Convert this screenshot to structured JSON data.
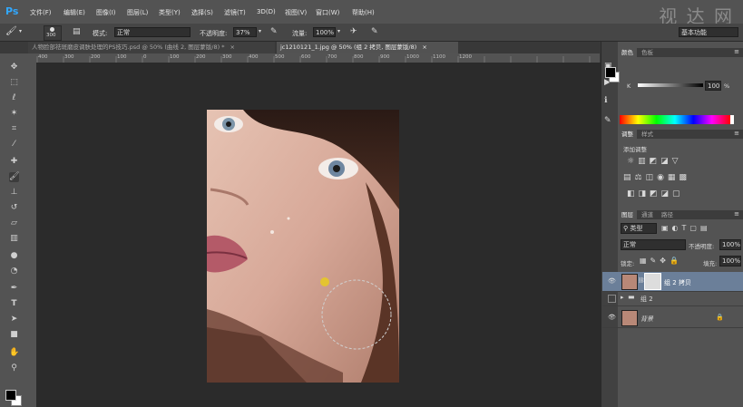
{
  "app": {
    "logo": "Ps",
    "watermark": "视 达 网"
  },
  "menu": [
    "文件(F)",
    "编辑(E)",
    "图像(I)",
    "图层(L)",
    "类型(Y)",
    "选择(S)",
    "滤镜(T)",
    "3D(D)",
    "视图(V)",
    "窗口(W)",
    "帮助(H)"
  ],
  "options": {
    "brush_size": "300",
    "mode_label": "模式:",
    "mode_value": "正常",
    "opacity_label": "不透明度:",
    "opacity_value": "37%",
    "flow_label": "流量:",
    "flow_value": "100%",
    "workspace": "基本功能"
  },
  "tabs": [
    {
      "label": "人物脸部祛斑磨皮调肤处理的PS技巧.psd @ 50% (曲线 2, 图层蒙版/8) *"
    },
    {
      "label": "jc1210121_1.jpg @ 50% (组 2 拷贝, 图层蒙版/8)"
    }
  ],
  "ruler_ticks": [
    "400",
    "350",
    "300",
    "250",
    "200",
    "150",
    "100",
    "50",
    "0",
    "50",
    "100",
    "150",
    "200",
    "250",
    "300",
    "350",
    "400",
    "450",
    "500",
    "550",
    "600",
    "650",
    "700",
    "750",
    "800",
    "850",
    "900",
    "950",
    "1000",
    "1050",
    "1100",
    "1150",
    "1200"
  ],
  "color_panel": {
    "tab_color": "颜色",
    "tab_swatches": "色板",
    "channel": "K",
    "value": "100",
    "unit": "%"
  },
  "adjustments_panel": {
    "tab_adjust": "调整",
    "tab_styles": "样式",
    "title": "添加调整"
  },
  "layers_panel": {
    "tab_layers": "图层",
    "tab_channels": "通道",
    "tab_paths": "路径",
    "filter": "类型",
    "blend_mode": "正常",
    "opacity_label": "不透明度:",
    "opacity_value": "100%",
    "lock_label": "锁定:",
    "fill_label": "填充:",
    "fill_value": "100%",
    "layers": [
      {
        "name": "组 2 拷贝",
        "selected": true
      },
      {
        "name": "组 2",
        "selected": false
      },
      {
        "name": "背景",
        "selected": false
      }
    ]
  },
  "colors": {
    "accent": "#31a8ff",
    "selected_layer": "#6b7f99",
    "menu_bg": "#535353",
    "canvas_bg": "#2b2b2b"
  }
}
